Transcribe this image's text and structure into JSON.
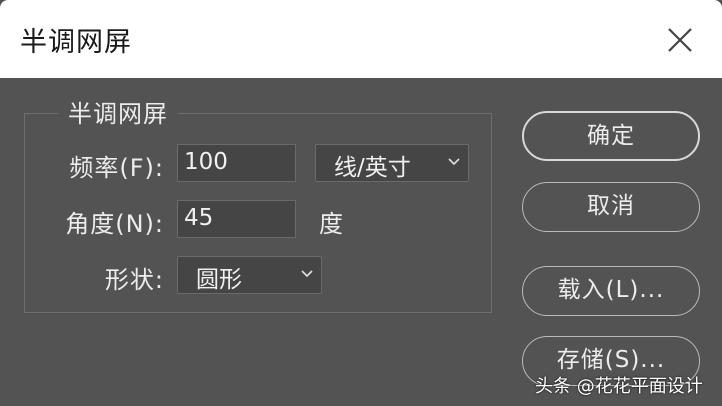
{
  "dialog": {
    "title": "半调网屏",
    "close_icon": "close-icon"
  },
  "group": {
    "legend": "半调网屏",
    "frequency": {
      "label": "频率(F):",
      "value": "100",
      "unit_selected": "线/英寸"
    },
    "angle": {
      "label": "角度(N):",
      "value": "45",
      "unit": "度"
    },
    "shape": {
      "label": "形状:",
      "selected": "圆形"
    }
  },
  "buttons": {
    "ok": "确定",
    "cancel": "取消",
    "load": "载入(L)...",
    "save": "存储(S)..."
  },
  "watermark": "头条 @花花平面设计"
}
